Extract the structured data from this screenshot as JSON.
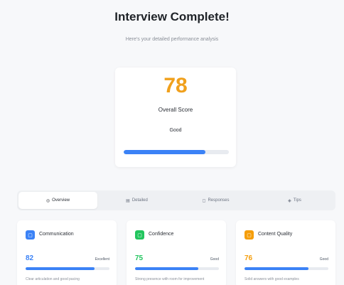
{
  "header": {
    "title": "Interview Complete!",
    "subtitle": "Here's your detailed performance analysis"
  },
  "score": {
    "value": "78",
    "label": "Overall Score",
    "rating": "Good",
    "progress_percent": 78,
    "color": "#f0a01c",
    "bar_color": "#3b82f6"
  },
  "tabs": [
    {
      "label": "Overview",
      "icon": "overview-icon",
      "active": true
    },
    {
      "label": "Detailed",
      "icon": "detailed-icon",
      "active": false
    },
    {
      "label": "Responses",
      "icon": "responses-icon",
      "active": false
    },
    {
      "label": "Tips",
      "icon": "tips-icon",
      "active": false
    }
  ],
  "metrics": [
    {
      "title": "Communication",
      "value": "82",
      "rating": "Excellent",
      "progress_percent": 82,
      "icon_color": "#3b82f6",
      "value_color": "#3b82f6",
      "icon": "chat-icon",
      "description": "Clear articulation and good pacing"
    },
    {
      "title": "Confidence",
      "value": "75",
      "rating": "Good",
      "progress_percent": 75,
      "icon_color": "#22c55e",
      "value_color": "#22c55e",
      "icon": "confidence-icon",
      "description": "Strong presence with room for improvement"
    },
    {
      "title": "Content Quality",
      "value": "76",
      "rating": "Good",
      "progress_percent": 76,
      "icon_color": "#f59e0b",
      "value_color": "#f59e0b",
      "icon": "content-icon",
      "description": "Solid answers with good examples"
    }
  ]
}
